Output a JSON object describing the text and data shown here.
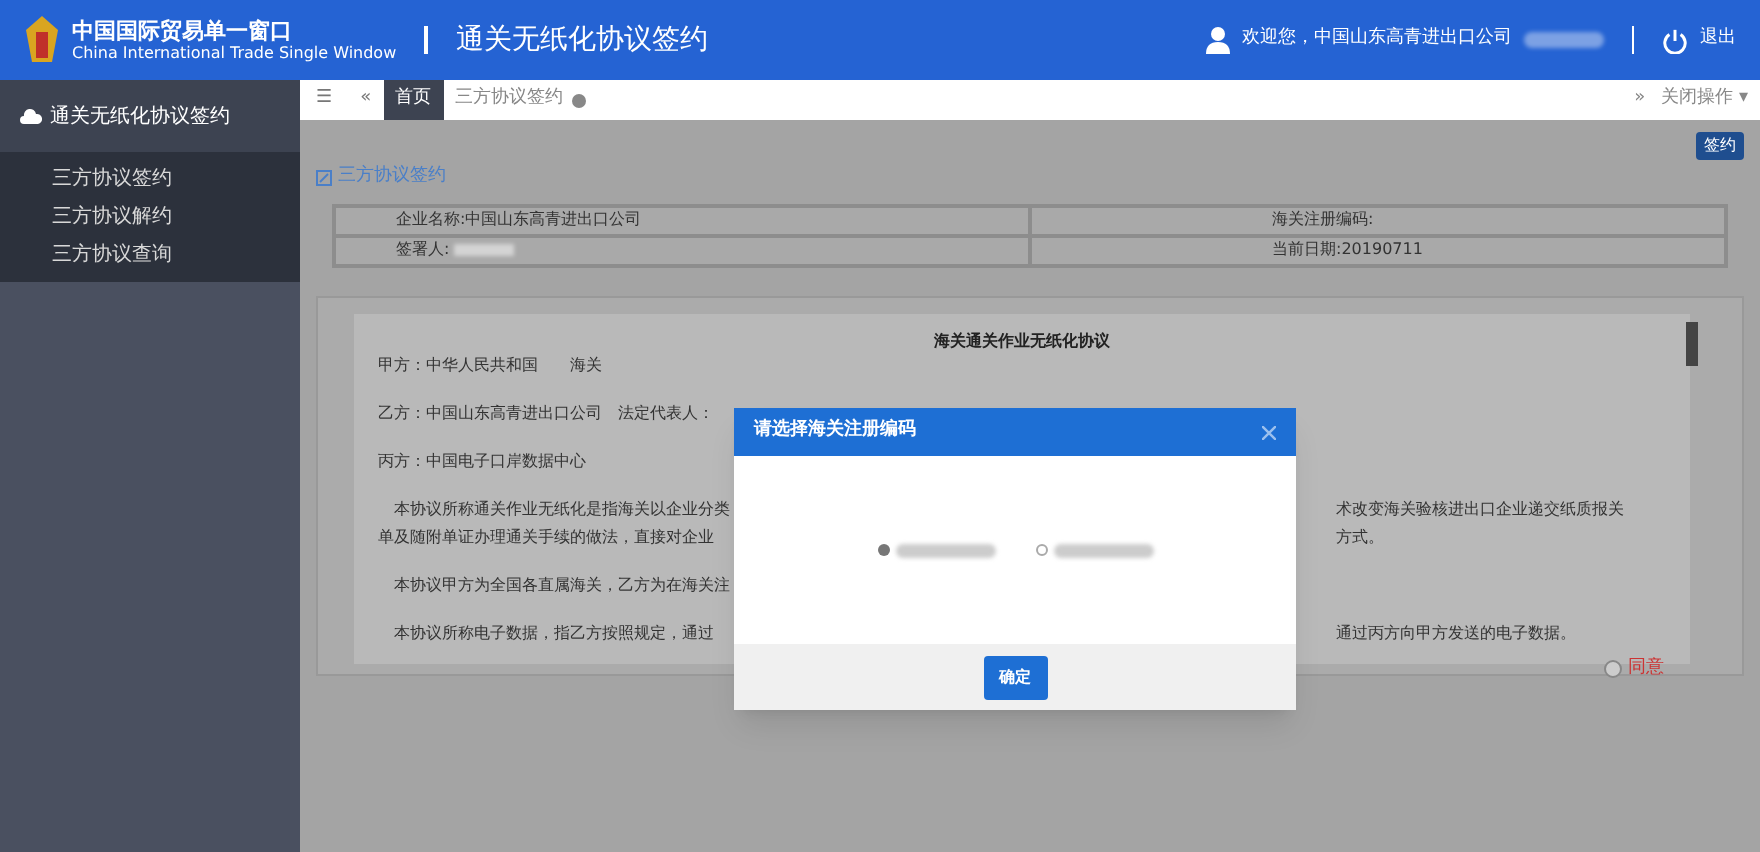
{
  "header": {
    "logo_title": "中国国际贸易单一窗口",
    "logo_subtitle": "China International Trade Single Window",
    "system_title": "通关无纸化协议签约",
    "welcome": "欢迎您，中国山东高青进出口公司",
    "logout": "退出"
  },
  "sidebar": {
    "title": "通关无纸化协议签约",
    "items": [
      {
        "label": "三方协议签约",
        "selected": false
      },
      {
        "label": "三方协议解约",
        "selected": false
      },
      {
        "label": "三方协议查询",
        "selected": false
      }
    ]
  },
  "tabs": [
    {
      "label": "首页",
      "selected": true,
      "closable": false
    },
    {
      "label": "三方协议签约",
      "selected": false,
      "closable": true
    }
  ],
  "tab_bar": {
    "menu": "☰",
    "scroll_left": "«",
    "scroll_right": "»"
  },
  "tab_actions": {
    "close_menu": "关闭操作 ▾"
  },
  "sign_button": "签约",
  "section_title": "三方协议签约",
  "form": [
    {
      "label": "企业名称:",
      "value": "中国山东高青进出口公司"
    },
    {
      "label": "海关注册编码:"
    },
    {
      "label": "签署人:",
      "redacted": true
    },
    {
      "label": "当前日期:",
      "value": "20190711"
    }
  ],
  "agreement": {
    "title": "海关通关作业无纸化协议",
    "lines": [
      {
        "left": "甲方：中华人民共和国　　海关"
      },
      {
        "left": "乙方：中国山东高青进出口公司　法定代表人："
      },
      {
        "left": "丙方：中国电子口岸数据中心"
      },
      {
        "left": "本协议所称通关作业无纸化是指海关以企业分类",
        "right": "术改变海关验核进出口企业递交纸质报关"
      },
      {
        "left": "单及随附单证办理通关手续的做法，直接对企业",
        "right": "方式。",
        "continuation": true
      },
      {
        "left": "本协议甲方为全国各直属海关，乙方为在海关注"
      },
      {
        "left": "本协议所称电子数据，指乙方按照规定，通过",
        "right": "通过丙方向甲方发送的电子数据。"
      }
    ]
  },
  "agree": {
    "label": "同意",
    "checked": false
  },
  "dialog": {
    "title": "请选择海关注册编码",
    "options": [
      {
        "selected": true
      },
      {
        "selected": false
      }
    ],
    "confirm": "确定"
  }
}
